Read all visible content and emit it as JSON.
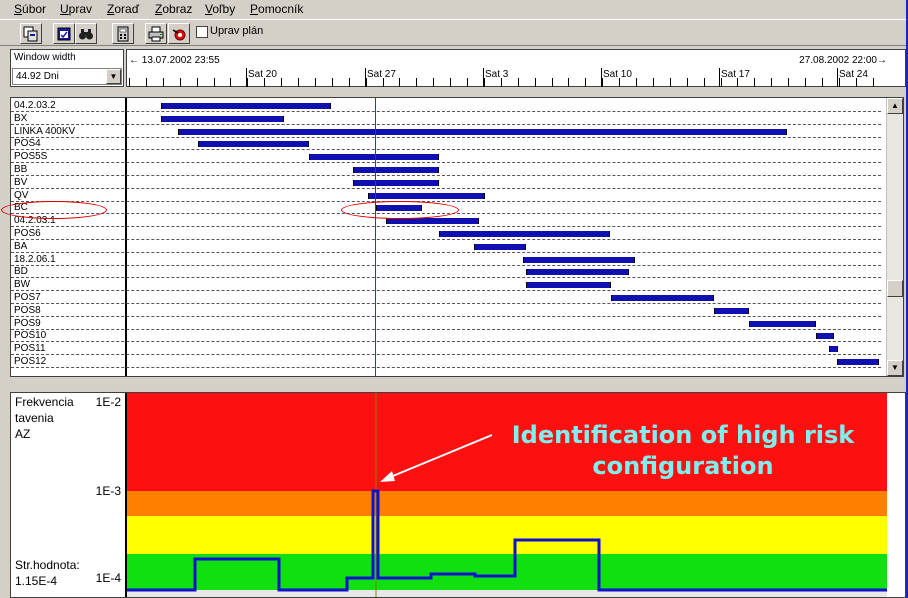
{
  "menu": [
    "Súbor",
    "Uprav",
    "Zoraď",
    "Zobraz",
    "Voľby",
    "Pomocník"
  ],
  "toolbar": {
    "buttons": [
      "copy-icon",
      "calendar-icon",
      "binoculars-icon",
      "calculator-icon",
      "print-icon",
      "run-icon"
    ],
    "checkbox_label": "Uprav plán",
    "checkbox_checked": false
  },
  "window_width": {
    "title": "Window width",
    "value": "44.92 Dni"
  },
  "timeline": {
    "start": "← 13.07.2002 23:55",
    "end": "27.08.2002 22:00→",
    "ticks": [
      "Sat 20",
      "Sat 27",
      "Sat 3",
      "Sat 10",
      "Sat 17",
      "Sat 24"
    ]
  },
  "gantt": {
    "rows": [
      {
        "label": "04.2.03.2",
        "start": 0.045,
        "end": 0.268
      },
      {
        "label": "BX",
        "start": 0.045,
        "end": 0.207
      },
      {
        "label": "LINKA 400KV",
        "start": 0.067,
        "end": 0.868
      },
      {
        "label": "POS4",
        "start": 0.093,
        "end": 0.239
      },
      {
        "label": "POS5S",
        "start": 0.239,
        "end": 0.411
      },
      {
        "label": "BB",
        "start": 0.298,
        "end": 0.411
      },
      {
        "label": "BV",
        "start": 0.298,
        "end": 0.411
      },
      {
        "label": "QV",
        "start": 0.317,
        "end": 0.471
      },
      {
        "label": "BC",
        "start": 0.327,
        "end": 0.388
      },
      {
        "label": "04.2.03.1",
        "start": 0.341,
        "end": 0.463
      },
      {
        "label": "POS6",
        "start": 0.411,
        "end": 0.636
      },
      {
        "label": "BA",
        "start": 0.457,
        "end": 0.525
      },
      {
        "label": "18.2.06.1",
        "start": 0.521,
        "end": 0.668
      },
      {
        "label": "BD",
        "start": 0.525,
        "end": 0.661
      },
      {
        "label": "BW",
        "start": 0.525,
        "end": 0.637
      },
      {
        "label": "POS7",
        "start": 0.637,
        "end": 0.772
      },
      {
        "label": "POS8",
        "start": 0.772,
        "end": 0.818
      },
      {
        "label": "POS9",
        "start": 0.818,
        "end": 0.906
      },
      {
        "label": "POS10",
        "start": 0.906,
        "end": 0.93
      },
      {
        "label": "POS11",
        "start": 0.924,
        "end": 0.935
      },
      {
        "label": "POS12",
        "start": 0.934,
        "end": 0.99
      }
    ]
  },
  "risk": {
    "ylabel_lines": [
      "Frekvencia",
      "tavenia",
      "AZ"
    ],
    "tick_top": "1E-2",
    "tick_mid": "1E-3",
    "tick_bottom": "1E-4",
    "mean_label": "Str.hodnota:",
    "mean_value": "1.15E-4",
    "zone_colors": {
      "red": "#ff1010",
      "orange": "#ff8000",
      "yellow": "#ffff00",
      "green": "#10e010"
    },
    "line_color": "#1010d0"
  },
  "annotation": {
    "line1": "Identification of high risk",
    "line2": "configuration",
    "color": "#7ff0f0"
  }
}
